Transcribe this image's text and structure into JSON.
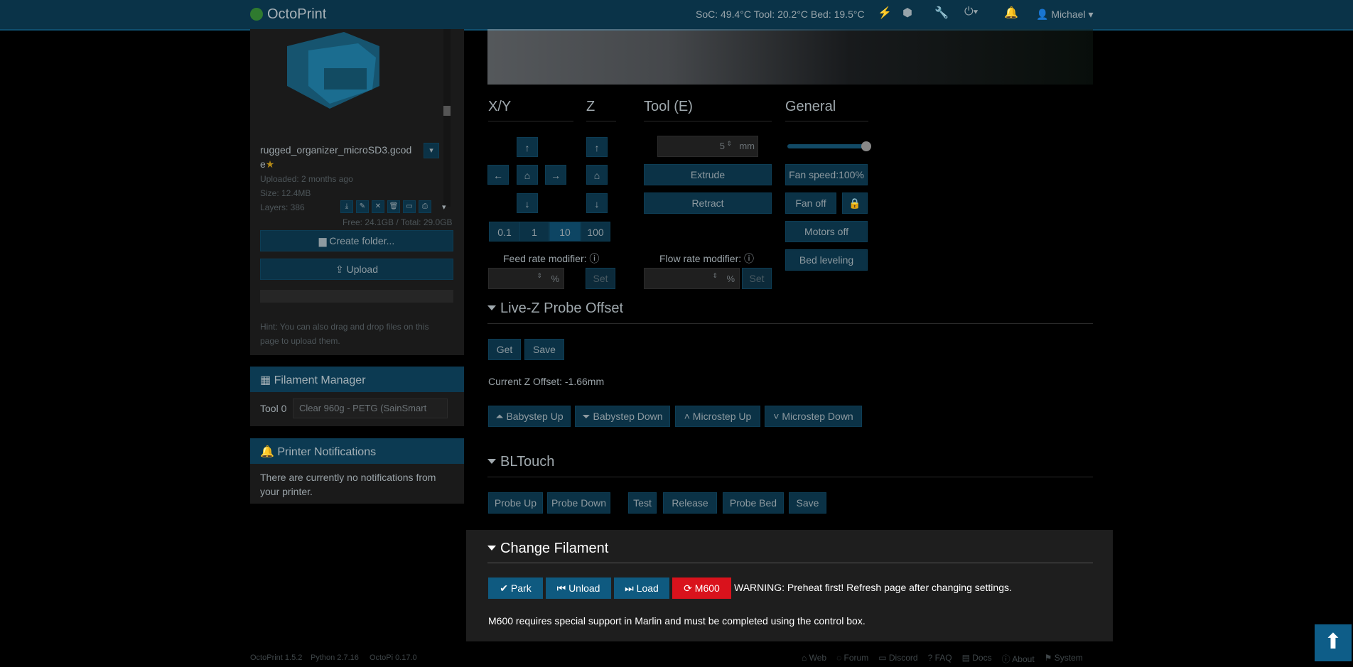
{
  "navbar": {
    "brand": "OctoPrint",
    "temps": "SoC: 49.4°C Tool: 20.2°C Bed: 19.5°C",
    "user": "Michael"
  },
  "files": {
    "filename": "rugged_organizer_microSD3.gcod",
    "filename_tail": "e",
    "uploaded": "Uploaded: 2 months ago",
    "size": "Size: 12.4MB",
    "layers": "Layers: 386",
    "free": "Free: 24.1GB / Total: 29.0GB",
    "create_folder": "Create folder...",
    "upload": "Upload",
    "hint": "Hint: You can also drag and drop files on this page to upload them."
  },
  "filament_manager": {
    "title": "Filament Manager",
    "tool_label": "Tool 0",
    "selected": "Clear 960g - PETG (SainSmart"
  },
  "notifications": {
    "title": "Printer Notifications",
    "text": "There are currently no notifications from your printer."
  },
  "controls": {
    "xy": "X/Y",
    "z": "Z",
    "tool": "Tool (E)",
    "general": "General",
    "steps": [
      "0.1",
      "1",
      "10",
      "100"
    ],
    "extrude_amount": "5",
    "mm": "mm",
    "extrude": "Extrude",
    "retract": "Retract",
    "fan_speed": "Fan speed:100%",
    "fan_off": "Fan off",
    "motors_off": "Motors off",
    "bed_leveling": "Bed leveling",
    "feed_rate": "Feed rate modifier:",
    "flow_rate": "Flow rate modifier:",
    "percent": "%",
    "set": "Set",
    "fan_slider": 1.0
  },
  "livez": {
    "title": "Live-Z Probe Offset",
    "get": "Get",
    "save": "Save",
    "current": "Current Z Offset: -1.66mm",
    "babystep_up": "Babystep Up",
    "babystep_down": "Babystep Down",
    "microstep_up": "Microstep Up",
    "microstep_down": "Microstep Down"
  },
  "bltouch": {
    "title": "BLTouch",
    "buttons": [
      "Probe Up",
      "Probe Down",
      "Test",
      "Release",
      "Probe Bed",
      "Save"
    ]
  },
  "change_filament": {
    "title": "Change Filament",
    "park": "Park",
    "unload": "Unload",
    "load": "Load",
    "m600": "M600",
    "warning": "WARNING: Preheat first! Refresh page after changing settings.",
    "note": "M600 requires special support in Marlin and must be completed using the control box."
  },
  "footer": {
    "octoprint": "OctoPrint 1.5.2",
    "python": "Python 2.7.16",
    "octopi": "OctoPi 0.17.0",
    "links": [
      "Web",
      "Forum",
      "Discord",
      "FAQ",
      "Docs",
      "About",
      "System"
    ]
  }
}
